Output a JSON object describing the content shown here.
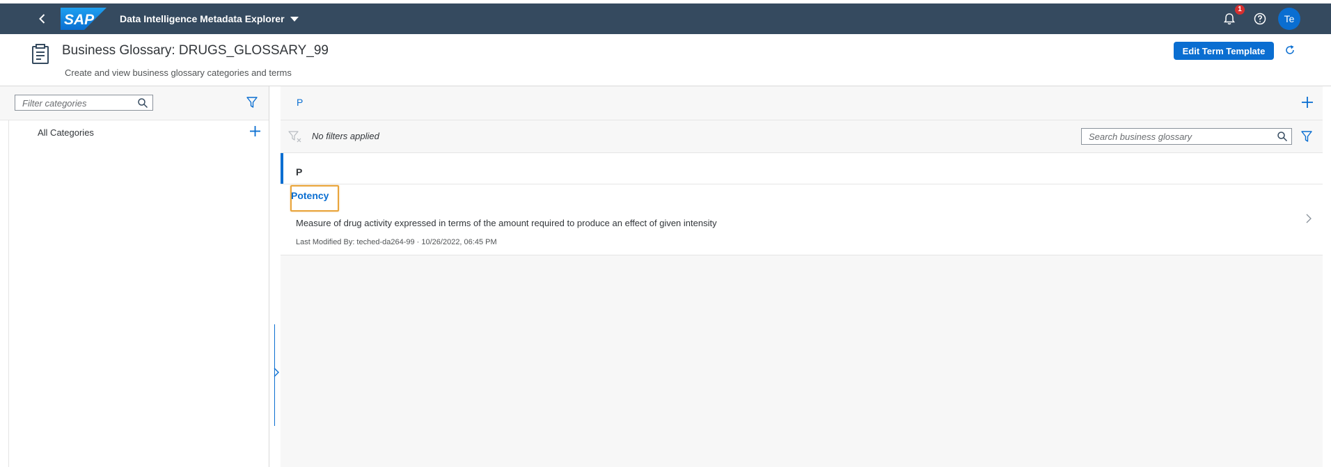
{
  "shell": {
    "logo_text": "SAP",
    "app_title": "Data Intelligence Metadata Explorer",
    "notification_count": "1",
    "user_initials": "Te"
  },
  "header": {
    "title": "Business Glossary: DRUGS_GLOSSARY_99",
    "subtitle": "Create and view business glossary categories and terms",
    "edit_button": "Edit Term Template"
  },
  "categories": {
    "filter_placeholder": "Filter categories",
    "items": [
      {
        "label": "All Categories"
      }
    ]
  },
  "glossary": {
    "selected_letter": "P",
    "filter_status": "No filters applied",
    "search_placeholder": "Search business glossary",
    "groups": [
      {
        "title": "P",
        "terms": [
          {
            "name": "Potency",
            "description": "Measure of drug activity expressed in terms of the amount required to produce an effect of given intensity",
            "meta": "Last Modified By: teched-da264-99  ·  10/26/2022, 06:45 PM"
          }
        ]
      }
    ]
  },
  "colors": {
    "shell_bg": "#354a5f",
    "brand_blue": "#0a6ed1",
    "focus_outline": "#e9a43a",
    "badge_red": "#d72f2f"
  },
  "icons": [
    "back-icon",
    "sap-logo",
    "dropdown-icon",
    "bell-icon",
    "help-icon",
    "glossary-page-icon",
    "refresh-icon",
    "search-icon",
    "filter-icon",
    "add-icon",
    "clear-filter-icon",
    "chevron-right-icon"
  ]
}
